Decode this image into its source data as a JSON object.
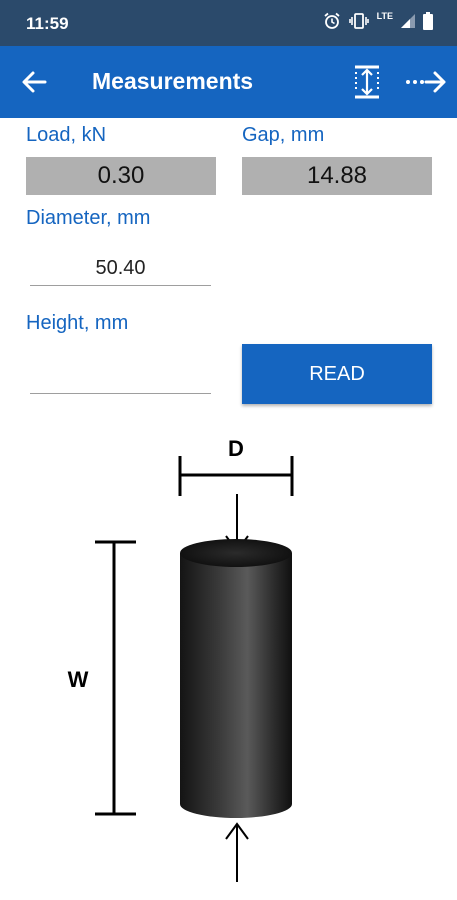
{
  "status_bar": {
    "time": "11:59",
    "network": "LTE"
  },
  "app_bar": {
    "title": "Measurements"
  },
  "fields": {
    "load": {
      "label": "Load, kN",
      "value": "0.30"
    },
    "gap": {
      "label": "Gap, mm",
      "value": "14.88"
    },
    "diameter": {
      "label": "Diameter, mm",
      "value": "50.40"
    },
    "height": {
      "label": "Height, mm",
      "value": ""
    }
  },
  "read_button": {
    "label": "READ"
  },
  "diagram": {
    "diameter_label": "D",
    "height_label": "W"
  }
}
